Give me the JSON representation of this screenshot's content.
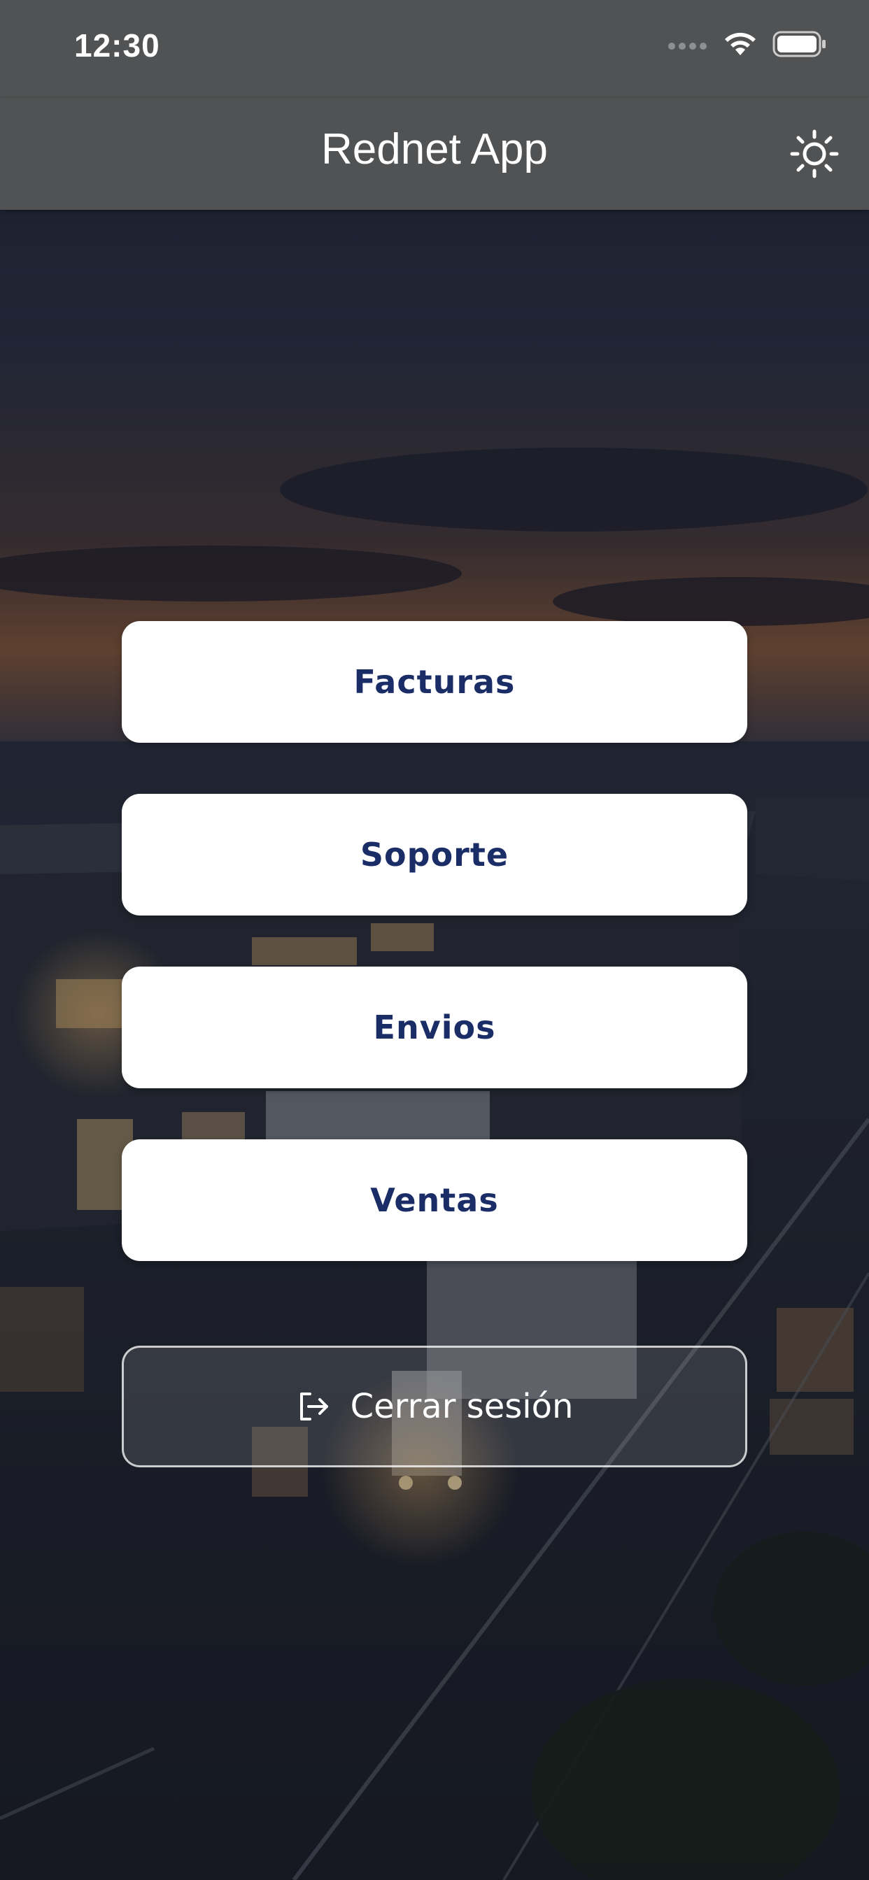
{
  "status_bar": {
    "time": "12:30",
    "icons": [
      "cellular-signal-icon",
      "wifi-icon",
      "battery-icon"
    ]
  },
  "app_bar": {
    "title": "Rednet App",
    "theme_toggle_icon": "sun-icon"
  },
  "menu": {
    "items": [
      {
        "label": "Facturas"
      },
      {
        "label": "Soporte"
      },
      {
        "label": "Envios"
      },
      {
        "label": "Ventas"
      }
    ]
  },
  "logout": {
    "label": "Cerrar sesión",
    "icon": "logout-icon"
  },
  "colors": {
    "app_bar_bg": "#515253",
    "button_bg": "#ffffff",
    "button_text": "#1a2d66",
    "logout_border": "#ffffff"
  }
}
